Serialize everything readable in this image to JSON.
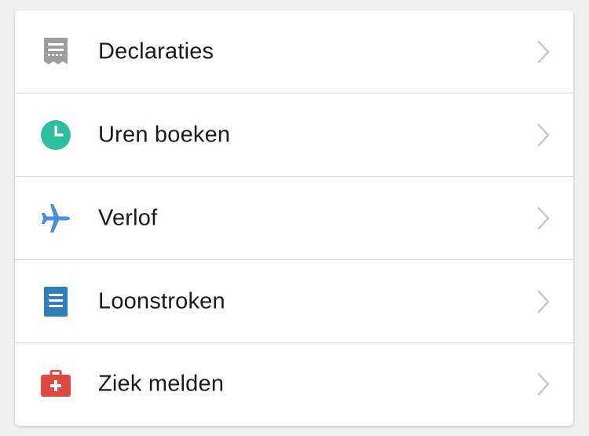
{
  "menu": {
    "items": [
      {
        "label": "Declaraties",
        "icon": "receipt-icon",
        "color": "#9e9e9e"
      },
      {
        "label": "Uren boeken",
        "icon": "clock-icon",
        "color": "#2bbf9f"
      },
      {
        "label": "Verlof",
        "icon": "airplane-icon",
        "color": "#4a90d9"
      },
      {
        "label": "Loonstroken",
        "icon": "document-icon",
        "color": "#2f7fbf"
      },
      {
        "label": "Ziek melden",
        "icon": "first-aid-kit-icon",
        "color": "#e0493f"
      }
    ]
  }
}
